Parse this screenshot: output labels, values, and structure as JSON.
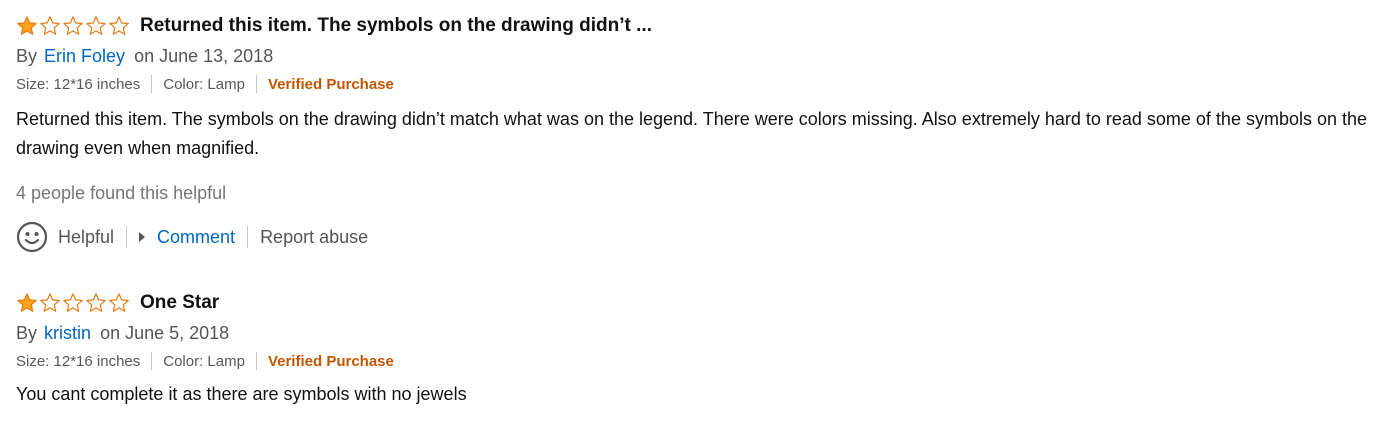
{
  "colors": {
    "star_fill": "#ffa41c",
    "star_outline": "#e47911",
    "link": "#0066c0",
    "verified": "#c45500",
    "muted": "#767676"
  },
  "reviews": [
    {
      "rating": 1,
      "max_rating": 5,
      "title": "Returned this item. The symbols on the drawing didn’t ...",
      "by_label": "By",
      "author": "Erin Foley",
      "date": "on June 13, 2018",
      "size": "Size: 12*16 inches",
      "color": "Color: Lamp",
      "verified": "Verified Purchase",
      "body": "Returned this item. The symbols on the drawing didn’t match what was on the legend. There were colors missing. Also extremely hard to read some of the symbols on the drawing even when magnified.",
      "helpful_count": "4 people found this helpful",
      "actions": {
        "helpful_icon": "smiley-face-icon",
        "helpful": "Helpful",
        "comment": "Comment",
        "report": "Report abuse"
      }
    },
    {
      "rating": 1,
      "max_rating": 5,
      "title": "One Star",
      "by_label": "By",
      "author": "kristin",
      "date": "on June 5, 2018",
      "size": "Size: 12*16 inches",
      "color": "Color: Lamp",
      "verified": "Verified Purchase",
      "body": "You cant complete it as there are symbols with no jewels"
    }
  ]
}
